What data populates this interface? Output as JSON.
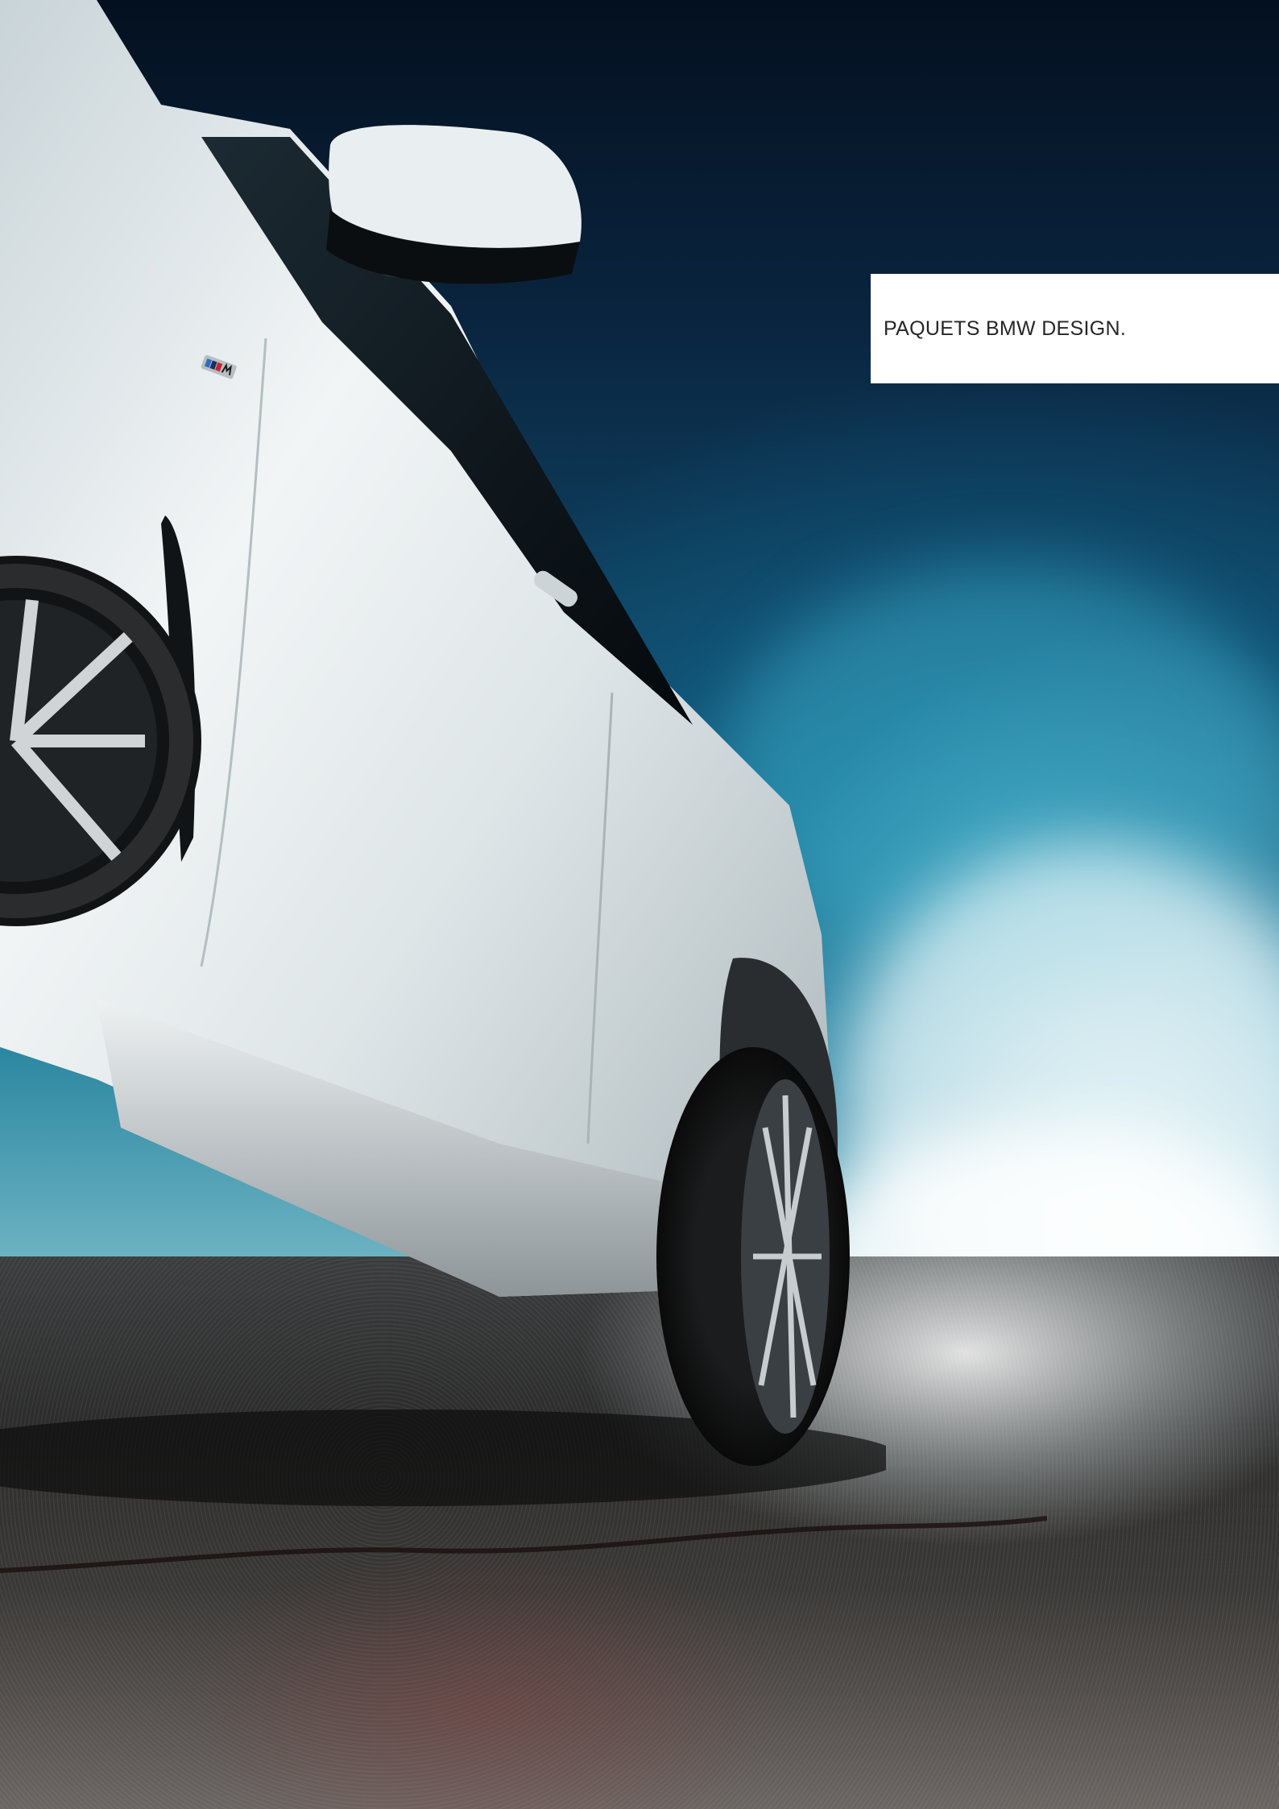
{
  "page": {
    "title": "PAQUETS BMW DESIGN."
  },
  "photo": {
    "subject": "car-side-view",
    "badge_icon": "m-badge-icon"
  },
  "colors": {
    "sky_top": "#04101f",
    "sky_mid": "#0f4a6a",
    "smoke": "#dceef2",
    "car_body": "#e8eced",
    "label_bg": "#ffffff",
    "label_text": "#262626"
  }
}
